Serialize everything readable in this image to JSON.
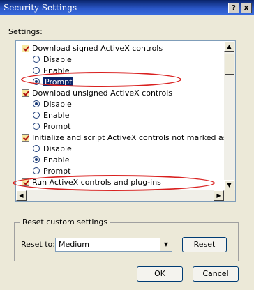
{
  "window": {
    "title": "Security Settings",
    "help_btn": "?",
    "close_btn": "x"
  },
  "settings_label": "Settings:",
  "list": {
    "items": [
      {
        "kind": "group",
        "label": "Download signed ActiveX controls"
      },
      {
        "kind": "option",
        "label": "Disable",
        "selected": false
      },
      {
        "kind": "option",
        "label": "Enable",
        "selected": false
      },
      {
        "kind": "option",
        "label": "Prompt",
        "selected": true,
        "highlighted": true
      },
      {
        "kind": "group",
        "label": "Download unsigned ActiveX controls"
      },
      {
        "kind": "option",
        "label": "Disable",
        "selected": true
      },
      {
        "kind": "option",
        "label": "Enable",
        "selected": false
      },
      {
        "kind": "option",
        "label": "Prompt",
        "selected": false
      },
      {
        "kind": "group",
        "label": "Initialize and script ActiveX controls not marked as safe"
      },
      {
        "kind": "option",
        "label": "Disable",
        "selected": false
      },
      {
        "kind": "option",
        "label": "Enable",
        "selected": true
      },
      {
        "kind": "option",
        "label": "Prompt",
        "selected": false
      },
      {
        "kind": "group",
        "label": "Run ActiveX controls and plug-ins"
      }
    ]
  },
  "reset": {
    "group_title": "Reset custom settings",
    "reset_to_label": "Reset to:",
    "combo_value": "Medium",
    "reset_button": "Reset"
  },
  "buttons": {
    "ok": "OK",
    "cancel": "Cancel"
  },
  "colors": {
    "annotation": "#d9201f",
    "selection": "#0a246a"
  }
}
